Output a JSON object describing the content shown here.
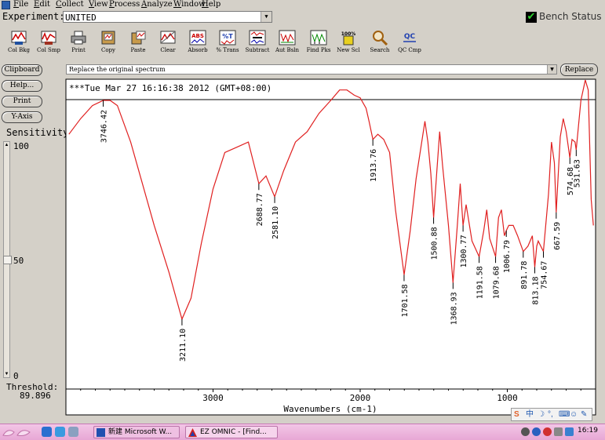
{
  "menu": {
    "items": [
      {
        "accel": "F",
        "rest": "ile"
      },
      {
        "accel": "E",
        "rest": "dit"
      },
      {
        "accel": "C",
        "rest": "ollect"
      },
      {
        "accel": "V",
        "rest": "iew"
      },
      {
        "accel": "P",
        "rest": "rocess"
      },
      {
        "accel": "A",
        "rest": "nalyze"
      },
      {
        "accel": "W",
        "rest": "indow"
      },
      {
        "accel": "H",
        "rest": "elp"
      }
    ]
  },
  "experiment": {
    "label": "Experiment:",
    "value": "UNITED"
  },
  "bench_status": {
    "label": "Bench Status",
    "check": "✔",
    "accent": "#2fd12f"
  },
  "toolbar": {
    "buttons": [
      {
        "label": "Col Bkg",
        "icon": "collect-background-icon"
      },
      {
        "label": "Col Smp",
        "icon": "collect-sample-icon"
      },
      {
        "label": "Print",
        "icon": "printer-icon"
      },
      {
        "label": "Copy",
        "icon": "copy-icon"
      },
      {
        "label": "Paste",
        "icon": "paste-icon"
      },
      {
        "label": "Clear",
        "icon": "clear-icon"
      },
      {
        "label": "Absorb",
        "icon": "absorbance-icon",
        "glyph": "ABS"
      },
      {
        "label": "% Trans",
        "icon": "transmittance-icon",
        "glyph": "%T"
      },
      {
        "label": "Subtract",
        "icon": "subtract-icon"
      },
      {
        "label": "Aut Bsln",
        "icon": "auto-baseline-icon"
      },
      {
        "label": "Find Pks",
        "icon": "find-peaks-icon"
      },
      {
        "label": "New Scl",
        "icon": "new-scale-icon",
        "glyph": "100%"
      },
      {
        "label": "Search",
        "icon": "search-icon"
      },
      {
        "label": "QC Cmp",
        "icon": "qc-compare-icon",
        "glyph": "QC"
      }
    ]
  },
  "replace": {
    "dropdown_value": "Replace the original spectrum",
    "button_label": "Replace"
  },
  "side_buttons": [
    "Clipboard",
    "Help...",
    "Print",
    "Y-Axis"
  ],
  "sensitivity": {
    "label": "Sensitivity:",
    "ticks": [
      "100",
      "50",
      "0"
    ],
    "value": 50
  },
  "threshold": {
    "label": "Threshold:",
    "value": "89.896"
  },
  "plot": {
    "header": "***Tue Mar 27 16:16:38 2012 (GMT+08:00)",
    "line_color": "#e02020"
  },
  "chart_data": {
    "type": "line",
    "xlabel": "Wavenumbers (cm-1)",
    "ylabel": "",
    "xlim": [
      4000,
      400
    ],
    "ylim": [
      0,
      100
    ],
    "xticks": [
      "3000",
      "2000",
      "1000"
    ],
    "series": [
      {
        "x": [
          3980,
          3900,
          3820,
          3746.42,
          3700,
          3650,
          3560,
          3480,
          3400,
          3300,
          3211.1,
          3150,
          3080,
          3000,
          2920,
          2840,
          2760,
          2688.77,
          2640,
          2581.1,
          2520,
          2440,
          2360,
          2280,
          2200,
          2140,
          2090,
          2040,
          2000,
          1960,
          1940,
          1913.76,
          1880,
          1840,
          1800,
          1760,
          1701.58,
          1660,
          1620,
          1560,
          1540,
          1520,
          1500.88,
          1480,
          1460,
          1440,
          1400,
          1368.93,
          1340,
          1320,
          1300.77,
          1280,
          1240,
          1191.58,
          1160,
          1140,
          1120,
          1079.68,
          1060,
          1040,
          1020,
          1006.79,
          990,
          960,
          930,
          891.78,
          860,
          830,
          813.18,
          800,
          790,
          754.67,
          720,
          700,
          680,
          667.59,
          640,
          620,
          600,
          574.68,
          560,
          540,
          531.63,
          500,
          470,
          450,
          430,
          415
        ],
        "y": [
          87,
          93,
          98,
          100,
          100,
          98,
          84,
          68,
          52,
          34,
          16,
          24,
          45,
          66,
          80,
          82,
          84,
          68,
          71,
          63,
          73,
          84,
          88,
          95,
          100,
          104,
          104,
          102,
          101,
          97,
          92,
          85,
          87,
          85,
          80,
          58,
          33,
          50,
          70,
          92,
          84,
          72,
          55,
          72,
          88,
          75,
          52,
          30,
          52,
          68,
          52,
          60,
          46,
          40,
          50,
          58,
          47,
          40,
          55,
          58,
          48,
          50,
          52,
          52,
          48,
          42,
          44,
          48,
          36,
          44,
          46,
          42,
          64,
          84,
          76,
          57,
          86,
          93,
          88,
          78,
          85,
          84,
          81,
          100,
          108,
          104,
          62,
          52
        ]
      }
    ],
    "peak_labels": [
      "3746.42",
      "3211.10",
      "2688.77",
      "2581.10",
      "1913.76",
      "1701.58",
      "1500.88",
      "1368.93",
      "1300.77",
      "1191.58",
      "1079.68",
      "1006.79",
      "891.78",
      "813.18",
      "754.67",
      "667.59",
      "574.68",
      "531.63"
    ],
    "grid": false
  },
  "taskbar": {
    "tasks": [
      {
        "label": "新建 Microsoft W...",
        "icon": "word-document-icon"
      },
      {
        "label": "EZ OMNIC - [Find...",
        "icon": "omnic-app-icon"
      }
    ],
    "clock": "16:19"
  }
}
